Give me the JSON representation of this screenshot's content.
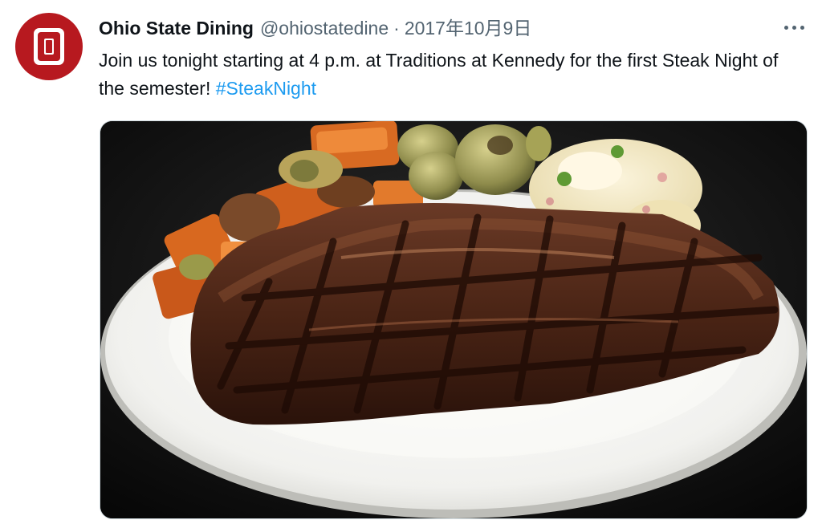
{
  "tweet": {
    "author": {
      "display_name": "Ohio State Dining",
      "handle": "@ohiostatedine",
      "avatar_icon": "block-o-logo-icon",
      "avatar_color": "#b7191f"
    },
    "separator": "·",
    "timestamp": "2017年10月9日",
    "text": "Join us tonight starting at 4 p.m. at Traditions at Kennedy for the first Steak Night of the semester!",
    "hashtag": "#SteakNight",
    "more_icon": "more-options-icon",
    "media": {
      "type": "photo",
      "subject": "grilled-steak-plate"
    }
  },
  "colors": {
    "text": "#0f1419",
    "secondary_text": "#536471",
    "link": "#1d9bf0",
    "brand": "#b7191f"
  }
}
